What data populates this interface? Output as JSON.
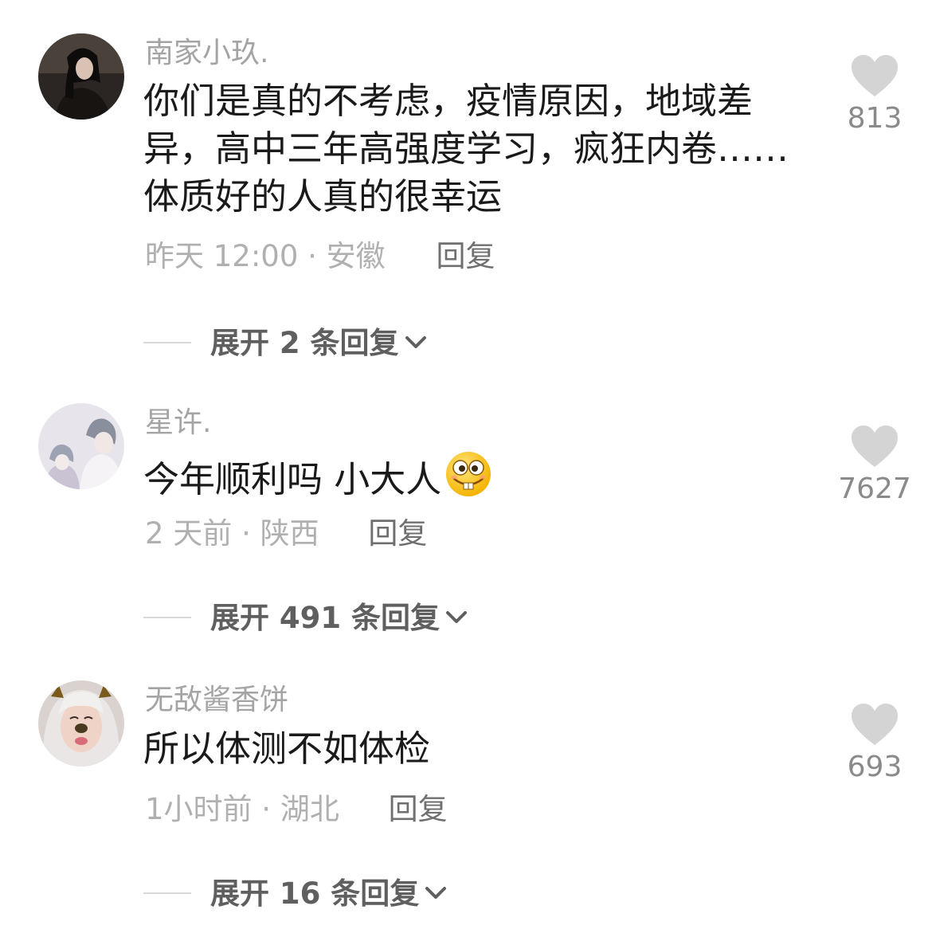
{
  "comments": [
    {
      "username": "南家小玖.",
      "text_lines": [
        "你们是真的不考虑，疫情原因，地域差",
        "异，高中三年高强度学习，疯狂内卷……",
        "体质好的人真的很幸运"
      ],
      "time_location": "昨天 12:00 · 安徽",
      "reply_label": "回复",
      "like_count": "813",
      "expand_label": "展开 2 条回复"
    },
    {
      "username": "星许.",
      "text": "今年顺利吗 小大人",
      "emoji": "grinning-buck-teeth-emoji",
      "time_location": "2 天前 · 陕西",
      "reply_label": "回复",
      "like_count": "7627",
      "expand_label": "展开 491 条回复"
    },
    {
      "username": "无敌酱香饼",
      "text": "所以体测不如体检",
      "time_location": "1小时前 · 湖北",
      "reply_label": "回复",
      "like_count": "693",
      "expand_label": "展开 16 条回复"
    }
  ],
  "icons": {
    "like": "heart-icon",
    "expand": "chevron-down-icon"
  },
  "colors": {
    "username": "#a4a4a4",
    "text": "#1a1a1a",
    "meta": "#b0b0b0",
    "reply": "#6f6f6f",
    "heart": "#d4d4d4",
    "like_count": "#8a8a8a"
  }
}
